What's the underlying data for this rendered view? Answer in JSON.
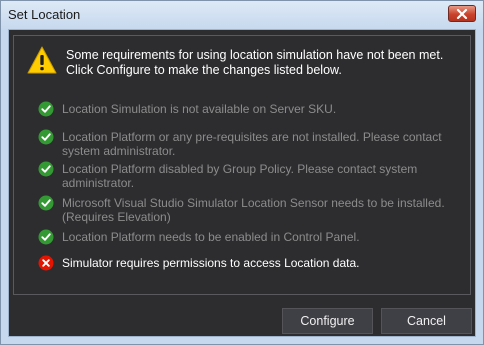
{
  "window": {
    "title": "Set Location"
  },
  "header": {
    "message": "Some requirements for using location simulation have not been met. Click Configure to make the changes listed below."
  },
  "requirements": [
    {
      "status": "met",
      "text": "Location Simulation is not available on Server SKU."
    },
    {
      "status": "met",
      "text": "Location Platform or any pre-requisites are not installed. Please contact system administrator."
    },
    {
      "status": "met",
      "text": "Location Platform disabled by Group Policy. Please contact system administrator."
    },
    {
      "status": "met",
      "text": "Microsoft Visual Studio Simulator Location Sensor needs to be installed. (Requires Elevation)"
    },
    {
      "status": "met",
      "text": "Location Platform needs to be enabled in Control Panel."
    },
    {
      "status": "not-met",
      "text": "Simulator requires permissions to access Location data."
    }
  ],
  "buttons": {
    "configure": "Configure",
    "cancel": "Cancel"
  },
  "colors": {
    "background": "#2d2d30",
    "check_green": "#339933",
    "error_red": "#e51400",
    "warning_yellow": "#ffcc00"
  },
  "icons": {
    "close": "close-icon",
    "warning": "warning-icon",
    "met": "check-circle-icon",
    "not_met": "error-circle-icon"
  }
}
